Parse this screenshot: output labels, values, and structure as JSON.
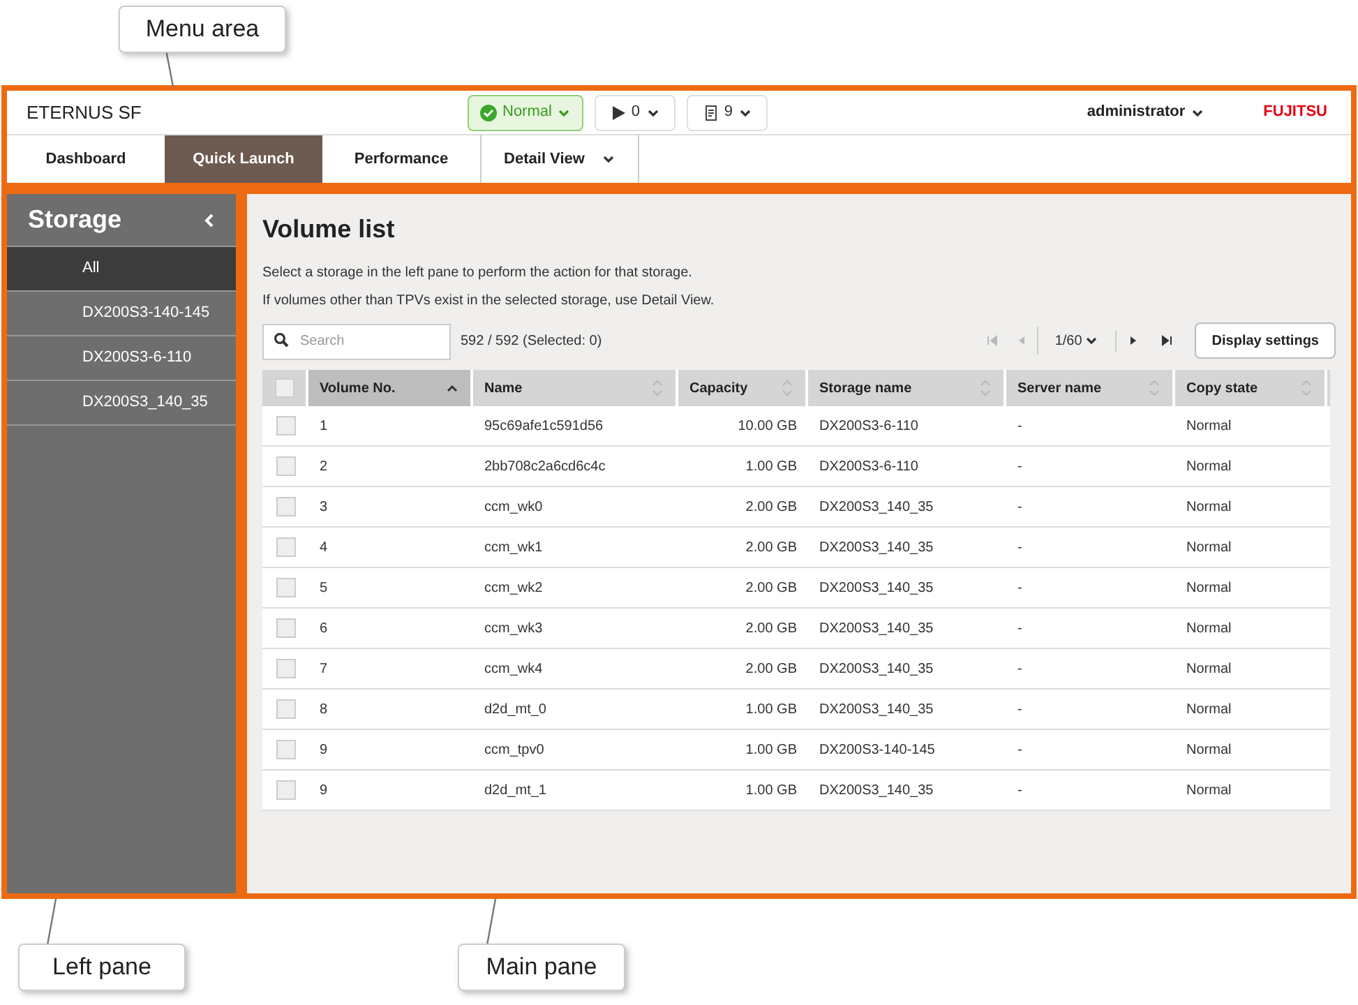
{
  "callouts": [
    {
      "label": "Menu area"
    },
    {
      "label": "Left pane"
    },
    {
      "label": "Main pane"
    }
  ],
  "header": {
    "product": "ETERNUS SF",
    "status": "Normal",
    "runs": "0",
    "logs": "9",
    "user": "administrator",
    "brand": "FUJITSU"
  },
  "tabs": [
    {
      "label": "Dashboard",
      "selected": false,
      "dropdown": false
    },
    {
      "label": "Quick Launch",
      "selected": true,
      "dropdown": false
    },
    {
      "label": "Performance",
      "selected": false,
      "dropdown": false
    },
    {
      "label": "Detail View",
      "selected": false,
      "dropdown": true
    }
  ],
  "sidebar": {
    "title": "Storage",
    "items": [
      {
        "label": "All",
        "selected": true
      },
      {
        "label": "DX200S3-140-145",
        "selected": false
      },
      {
        "label": "DX200S3-6-110",
        "selected": false
      },
      {
        "label": "DX200S3_140_35",
        "selected": false
      }
    ]
  },
  "main": {
    "title": "Volume list",
    "notes": [
      "Select a storage in the left pane to perform the action for that storage.",
      "If volumes other than TPVs exist in the selected storage, use Detail View."
    ],
    "search": {
      "placeholder": "Search"
    },
    "count": "592 / 592 (Selected: 0)",
    "page": "1/60",
    "settings_button": "Display settings"
  },
  "table": {
    "all_checked": false,
    "columns": [
      {
        "label": "Volume No.",
        "sorted": true
      },
      {
        "label": "Name",
        "sorted": false
      },
      {
        "label": "Capacity",
        "sorted": false
      },
      {
        "label": "Storage name",
        "sorted": false
      },
      {
        "label": "Server name",
        "sorted": false
      },
      {
        "label": "Copy state",
        "sorted": false
      }
    ],
    "rows": [
      {
        "checked": false,
        "cells": [
          "1",
          "95c69afe1c591d56",
          "10.00 GB",
          "DX200S3-6-110",
          "-",
          "Normal"
        ]
      },
      {
        "checked": false,
        "cells": [
          "2",
          "2bb708c2a6cd6c4c",
          "1.00 GB",
          "DX200S3-6-110",
          "-",
          "Normal"
        ]
      },
      {
        "checked": false,
        "cells": [
          "3",
          "ccm_wk0",
          "2.00 GB",
          "DX200S3_140_35",
          "-",
          "Normal"
        ]
      },
      {
        "checked": false,
        "cells": [
          "4",
          "ccm_wk1",
          "2.00 GB",
          "DX200S3_140_35",
          "-",
          "Normal"
        ]
      },
      {
        "checked": false,
        "cells": [
          "5",
          "ccm_wk2",
          "2.00 GB",
          "DX200S3_140_35",
          "-",
          "Normal"
        ]
      },
      {
        "checked": false,
        "cells": [
          "6",
          "ccm_wk3",
          "2.00 GB",
          "DX200S3_140_35",
          "-",
          "Normal"
        ]
      },
      {
        "checked": false,
        "cells": [
          "7",
          "ccm_wk4",
          "2.00 GB",
          "DX200S3_140_35",
          "-",
          "Normal"
        ]
      },
      {
        "checked": false,
        "cells": [
          "8",
          "d2d_mt_0",
          "1.00 GB",
          "DX200S3_140_35",
          "-",
          "Normal"
        ]
      },
      {
        "checked": false,
        "cells": [
          "9",
          "ccm_tpv0",
          "1.00 GB",
          "DX200S3-140-145",
          "-",
          "Normal"
        ]
      },
      {
        "checked": false,
        "cells": [
          "9",
          "d2d_mt_1",
          "1.00 GB",
          "DX200S3_140_35",
          "-",
          "Normal"
        ]
      }
    ]
  }
}
